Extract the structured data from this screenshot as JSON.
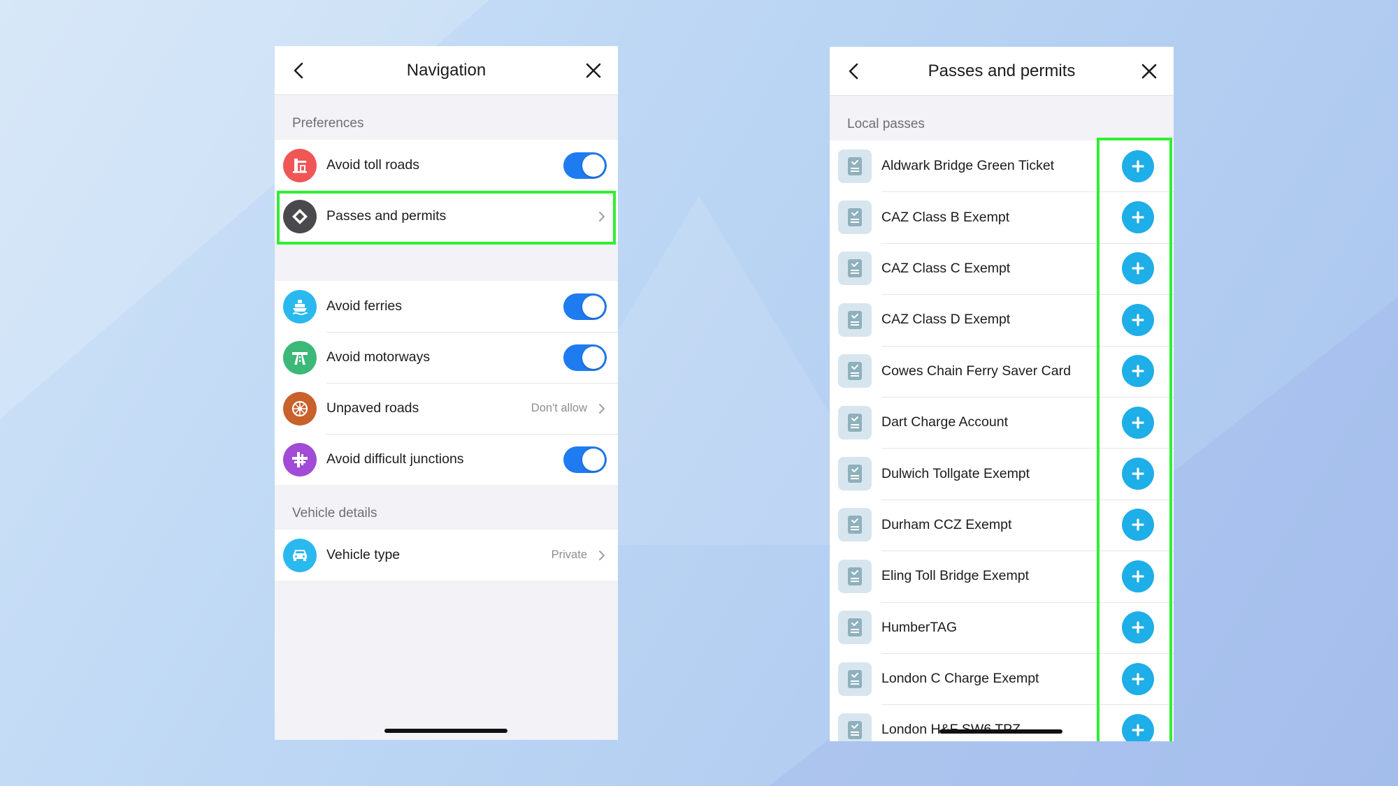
{
  "left_screen": {
    "header": {
      "title": "Navigation",
      "back_icon": "chevron-left-icon",
      "close_icon": "close-icon"
    },
    "sections": {
      "preferences_label": "Preferences",
      "vehicle_details_label": "Vehicle details"
    },
    "rows": [
      {
        "label": "Avoid toll roads",
        "icon": "toll-booth-icon",
        "icon_color": "#f05656",
        "control": "toggle",
        "on": true
      },
      {
        "label": "Passes and permits",
        "icon": "diamond-sign-icon",
        "icon_color": "#4a4a4e",
        "control": "chevron",
        "highlighted": true
      },
      {
        "label": "Avoid ferries",
        "icon": "ferry-icon",
        "icon_color": "#2ab9ef",
        "control": "toggle",
        "on": true
      },
      {
        "label": "Avoid motorways",
        "icon": "motorway-icon",
        "icon_color": "#3cb878",
        "control": "toggle",
        "on": true
      },
      {
        "label": "Unpaved roads",
        "icon": "wheel-icon",
        "icon_color": "#c8612a",
        "control": "chevron",
        "value": "Don't allow"
      },
      {
        "label": "Avoid difficult junctions",
        "icon": "junction-icon",
        "icon_color": "#a24bd6",
        "control": "toggle",
        "on": true
      },
      {
        "label": "Vehicle type",
        "icon": "car-icon",
        "icon_color": "#2ab9ef",
        "control": "chevron",
        "value": "Private"
      }
    ]
  },
  "right_screen": {
    "header": {
      "title": "Passes and permits",
      "back_icon": "chevron-left-icon",
      "close_icon": "close-icon"
    },
    "section_label": "Local passes",
    "passes": [
      "Aldwark Bridge Green Ticket",
      "CAZ Class B Exempt",
      "CAZ Class C Exempt",
      "CAZ Class D Exempt",
      "Cowes Chain Ferry Saver Card",
      "Dart Charge Account",
      "Dulwich Tollgate Exempt",
      "Durham CCZ Exempt",
      "Eling Toll Bridge Exempt",
      "HumberTAG",
      "London C Charge Exempt",
      "London H&F SW6 TPZ"
    ],
    "pass_icon": "permit-document-icon",
    "add_icon": "plus-icon",
    "add_button_color": "#1eaee8"
  },
  "colors": {
    "toggle_on": "#1e7cf0",
    "highlight": "#33ee33"
  }
}
